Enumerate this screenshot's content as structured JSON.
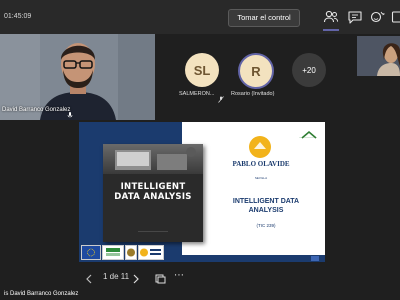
{
  "topbar": {
    "timer": "01:45:09",
    "take_control_label": "Tomar el control",
    "icons": [
      "participants-icon",
      "chat-icon",
      "reactions-icon",
      "view-icon"
    ]
  },
  "camera": {
    "name": "David Barranco Gonzalez"
  },
  "participants": [
    {
      "initials": "SL",
      "label": "SALMERON..."
    },
    {
      "initials": "R",
      "label": "Rosario (Invitado)"
    }
  ],
  "more_count": "+20",
  "slide": {
    "book_title": "INTELLIGENT DATA ANALYSIS",
    "university_name": "PABLO OLAVIDE",
    "university_city": "SEVILLA",
    "title": "INTELLIGENT DATA ANALYSIS",
    "code": "(TIC 239)"
  },
  "navigation": {
    "page_indicator": "1 de 11"
  },
  "presenter_label": "is David Barranco Gonzalez",
  "colors": {
    "accent": "#6264a7",
    "slide_blue": "#1b3b6e",
    "logo_gold": "#f2b31b"
  }
}
